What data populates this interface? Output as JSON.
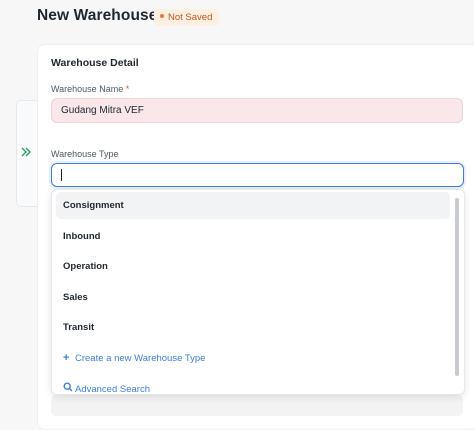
{
  "page": {
    "title": "New Warehouse",
    "status": "Not Saved"
  },
  "section": {
    "title": "Warehouse Detail"
  },
  "fields": {
    "warehouse_name": {
      "label": "Warehouse Name",
      "required_mark": "*",
      "value": "Gudang Mitra VEF"
    },
    "warehouse_type": {
      "label": "Warehouse Type",
      "value": ""
    }
  },
  "dropdown": {
    "options": [
      {
        "label": "Consignment"
      },
      {
        "label": "Inbound"
      },
      {
        "label": "Operation"
      },
      {
        "label": "Sales"
      },
      {
        "label": "Transit"
      }
    ],
    "create_label": "Create a new Warehouse Type",
    "advanced_search_label": "Advanced Search"
  },
  "icons": {
    "sidebar_toggle": "double-chevron-right-icon",
    "create": "plus-icon",
    "search": "search-icon",
    "status_dot": "dot-icon"
  },
  "colors": {
    "accent": "#3b7fdc",
    "status_text": "#c0571a",
    "status_bg": "#fdf0e3",
    "required_bg": "#f9e7ea",
    "toggle": "#2f9e6a"
  }
}
